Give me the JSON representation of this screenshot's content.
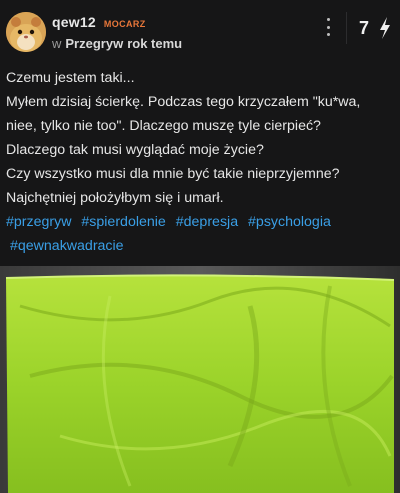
{
  "post": {
    "author": "qew12",
    "rank": "MOCARZ",
    "in_label": "w",
    "category": "Przegryw",
    "time": "rok temu",
    "votes": "7",
    "body_lines": [
      "Czemu jestem taki...",
      "Myłem dzisiaj ścierkę. Podczas tego krzyczałem \"ku*wa,",
      "niee, tylko nie too\". Dlaczego muszę tyle cierpieć?",
      "Dlaczego tak musi wyglądać moje życie?",
      "Czy wszystko musi dla mnie być takie nieprzyjemne?",
      "Najchętniej położyłbym się i umarł."
    ],
    "tags": [
      "#przegryw",
      "#spierdolenie",
      "#depresja",
      "#psychologia",
      "#qewnakwadracie"
    ],
    "icons": {
      "avatar": "hamster-avatar",
      "more": "more-vertical-icon",
      "vote": "lightning-bolt-icon"
    },
    "colors": {
      "background": "#161617",
      "rank": "#e8773a",
      "tag": "#3a9fe6",
      "cloth": "#9bd32a"
    }
  }
}
